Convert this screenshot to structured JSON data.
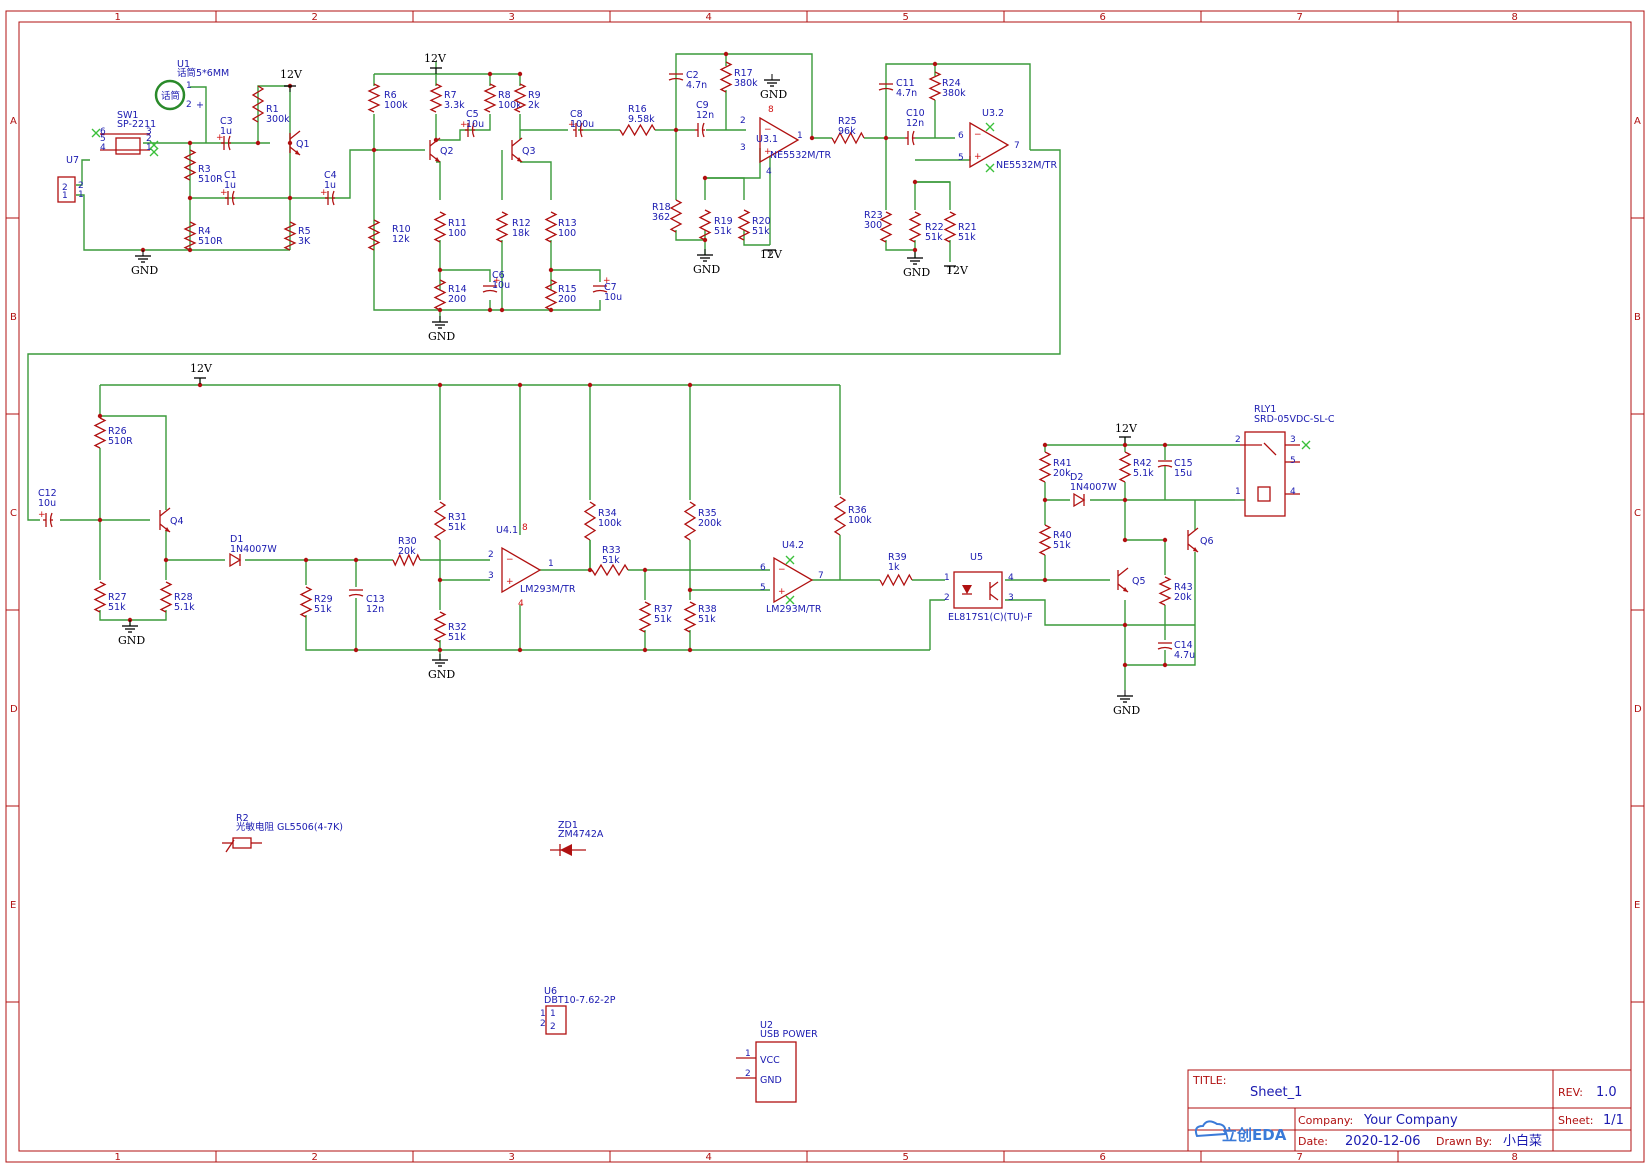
{
  "frame": {
    "cols": [
      "1",
      "2",
      "3",
      "4",
      "5",
      "6",
      "7",
      "8"
    ],
    "rows": [
      "A",
      "B",
      "C",
      "D",
      "E"
    ]
  },
  "nets": {
    "gnd": "GND",
    "v12": "12V"
  },
  "components": {
    "U1": {
      "ref": "U1",
      "value": "话筒5*6MM",
      "inner": "话筒"
    },
    "U7": {
      "ref": "U7"
    },
    "SW1": {
      "ref": "SW1",
      "value": "SP-2211"
    },
    "R1": {
      "ref": "R1",
      "value": "300k"
    },
    "R3": {
      "ref": "R3",
      "value": "510R"
    },
    "R4": {
      "ref": "R4",
      "value": "510R"
    },
    "R5": {
      "ref": "R5",
      "value": "3K"
    },
    "C1": {
      "ref": "C1",
      "value": "1u"
    },
    "C3": {
      "ref": "C3",
      "value": "1u"
    },
    "C4": {
      "ref": "C4",
      "value": "1u"
    },
    "Q1": {
      "ref": "Q1"
    },
    "R6": {
      "ref": "R6",
      "value": "100k"
    },
    "R7": {
      "ref": "R7",
      "value": "3.3k"
    },
    "R8": {
      "ref": "R8",
      "value": "100k"
    },
    "R9": {
      "ref": "R9",
      "value": "2k"
    },
    "R10": {
      "ref": "R10",
      "value": "12k"
    },
    "R11": {
      "ref": "R11",
      "value": "100"
    },
    "R12": {
      "ref": "R12",
      "value": "18k"
    },
    "R13": {
      "ref": "R13",
      "value": "100"
    },
    "R14": {
      "ref": "R14",
      "value": "200"
    },
    "R15": {
      "ref": "R15",
      "value": "200"
    },
    "C5": {
      "ref": "C5",
      "value": "10u"
    },
    "C6": {
      "ref": "C6",
      "value": "10u"
    },
    "C7": {
      "ref": "C7",
      "value": "10u"
    },
    "C8": {
      "ref": "C8",
      "value": "100u"
    },
    "Q2": {
      "ref": "Q2"
    },
    "Q3": {
      "ref": "Q3"
    },
    "R16": {
      "ref": "R16",
      "value": "9.58k"
    },
    "C2": {
      "ref": "C2",
      "value": "4.7n"
    },
    "R17": {
      "ref": "R17",
      "value": "380k"
    },
    "C9": {
      "ref": "C9",
      "value": "12n"
    },
    "U3_1": {
      "ref": "U3.1",
      "value": "NE5532M/TR"
    },
    "R18": {
      "ref": "R18",
      "value": "362"
    },
    "R19": {
      "ref": "R19",
      "value": "51k"
    },
    "R20": {
      "ref": "R20",
      "value": "51k"
    },
    "R25": {
      "ref": "R25",
      "value": "96k"
    },
    "C11": {
      "ref": "C11",
      "value": "4.7n"
    },
    "R24": {
      "ref": "R24",
      "value": "380k"
    },
    "C10": {
      "ref": "C10",
      "value": "12n"
    },
    "U3_2": {
      "ref": "U3.2",
      "value": "NE5532M/TR"
    },
    "R23": {
      "ref": "R23",
      "value": "300"
    },
    "R22": {
      "ref": "R22",
      "value": "51k"
    },
    "R21": {
      "ref": "R21",
      "value": "51k"
    },
    "C12": {
      "ref": "C12",
      "value": "10u"
    },
    "R26": {
      "ref": "R26",
      "value": "510R"
    },
    "Q4": {
      "ref": "Q4"
    },
    "R27": {
      "ref": "R27",
      "value": "51k"
    },
    "R28": {
      "ref": "R28",
      "value": "5.1k"
    },
    "D1": {
      "ref": "D1",
      "value": "1N4007W"
    },
    "R29": {
      "ref": "R29",
      "value": "51k"
    },
    "C13": {
      "ref": "C13",
      "value": "12n"
    },
    "R30": {
      "ref": "R30",
      "value": "20k"
    },
    "R31": {
      "ref": "R31",
      "value": "51k"
    },
    "R32": {
      "ref": "R32",
      "value": "51k"
    },
    "U4_1": {
      "ref": "U4.1",
      "value": "LM293M/TR"
    },
    "R34": {
      "ref": "R34",
      "value": "100k"
    },
    "R33": {
      "ref": "R33",
      "value": "51k"
    },
    "R35": {
      "ref": "R35",
      "value": "200k"
    },
    "R37": {
      "ref": "R37",
      "value": "51k"
    },
    "R38": {
      "ref": "R38",
      "value": "51k"
    },
    "U4_2": {
      "ref": "U4.2",
      "value": "LM293M/TR"
    },
    "R36": {
      "ref": "R36",
      "value": "100k"
    },
    "R39": {
      "ref": "R39",
      "value": "1k"
    },
    "U5": {
      "ref": "U5",
      "value": "EL817S1(C)(TU)-F"
    },
    "R41": {
      "ref": "R41",
      "value": "20k"
    },
    "R40": {
      "ref": "R40",
      "value": "51k"
    },
    "D2": {
      "ref": "D2",
      "value": "1N4007W"
    },
    "R42": {
      "ref": "R42",
      "value": "5.1k"
    },
    "C15": {
      "ref": "C15",
      "value": "15u"
    },
    "Q5": {
      "ref": "Q5"
    },
    "Q6": {
      "ref": "Q6"
    },
    "R43": {
      "ref": "R43",
      "value": "20k"
    },
    "C14": {
      "ref": "C14",
      "value": "4.7u"
    },
    "RLY1": {
      "ref": "RLY1",
      "value": "SRD-05VDC-SL-C"
    },
    "R2": {
      "ref": "R2",
      "value": "光敏电阻 GL5506(4-7K)"
    },
    "ZD1": {
      "ref": "ZD1",
      "value": "ZM4742A"
    },
    "U6": {
      "ref": "U6",
      "value": "DBT10-7.62-2P"
    },
    "U2": {
      "ref": "U2",
      "value": "USB POWER",
      "pin1": "VCC",
      "pin2": "GND"
    }
  },
  "title_block": {
    "title_label": "TITLE:",
    "title": "Sheet_1",
    "rev_label": "REV:",
    "rev": "1.0",
    "company_label": "Company:",
    "company": "Your Company",
    "sheet_label": "Sheet:",
    "sheet": "1/1",
    "date_label": "Date:",
    "date": "2020-12-06",
    "drawn_label": "Drawn By:",
    "drawn": "小白菜",
    "logo": "立创EDA"
  }
}
